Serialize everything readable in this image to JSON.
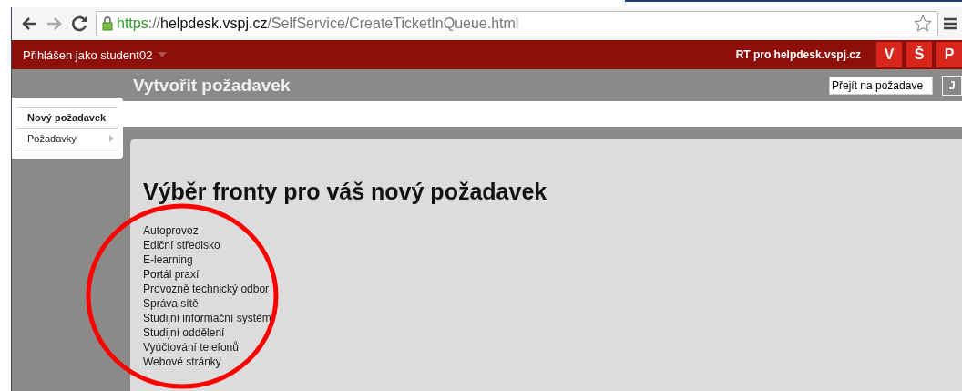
{
  "browser": {
    "url": {
      "scheme": "https",
      "separator": "://",
      "host": "helpdesk.vspj.cz",
      "path": "/SelfService/CreateTicketInQueue.html"
    }
  },
  "topbar": {
    "user": "Přihlášen jako student02",
    "site": "RT pro helpdesk.vspj.cz",
    "tabs": [
      "V",
      "Š",
      "P"
    ]
  },
  "header": {
    "title": "Vytvořit požadavek",
    "search": {
      "value": "Přejít na požadave"
    },
    "button": "J"
  },
  "sidebar": {
    "items": [
      {
        "label": "Nový požadavek",
        "selected": true,
        "has_submenu": false
      },
      {
        "label": "Požadavky",
        "selected": false,
        "has_submenu": true
      }
    ]
  },
  "content": {
    "heading": "Výběr fronty pro váš nový požadavek",
    "queues": [
      "Autoprovoz",
      "Ediční středisko",
      "E-learning",
      "Portál praxí",
      "Provozně technický odbor",
      "Správa sítě",
      "Studijní informační systém",
      "Studijní oddělení",
      "Vyúčtování telefonů",
      "Webové stránky"
    ]
  },
  "annotation": {
    "kind": "circle"
  }
}
